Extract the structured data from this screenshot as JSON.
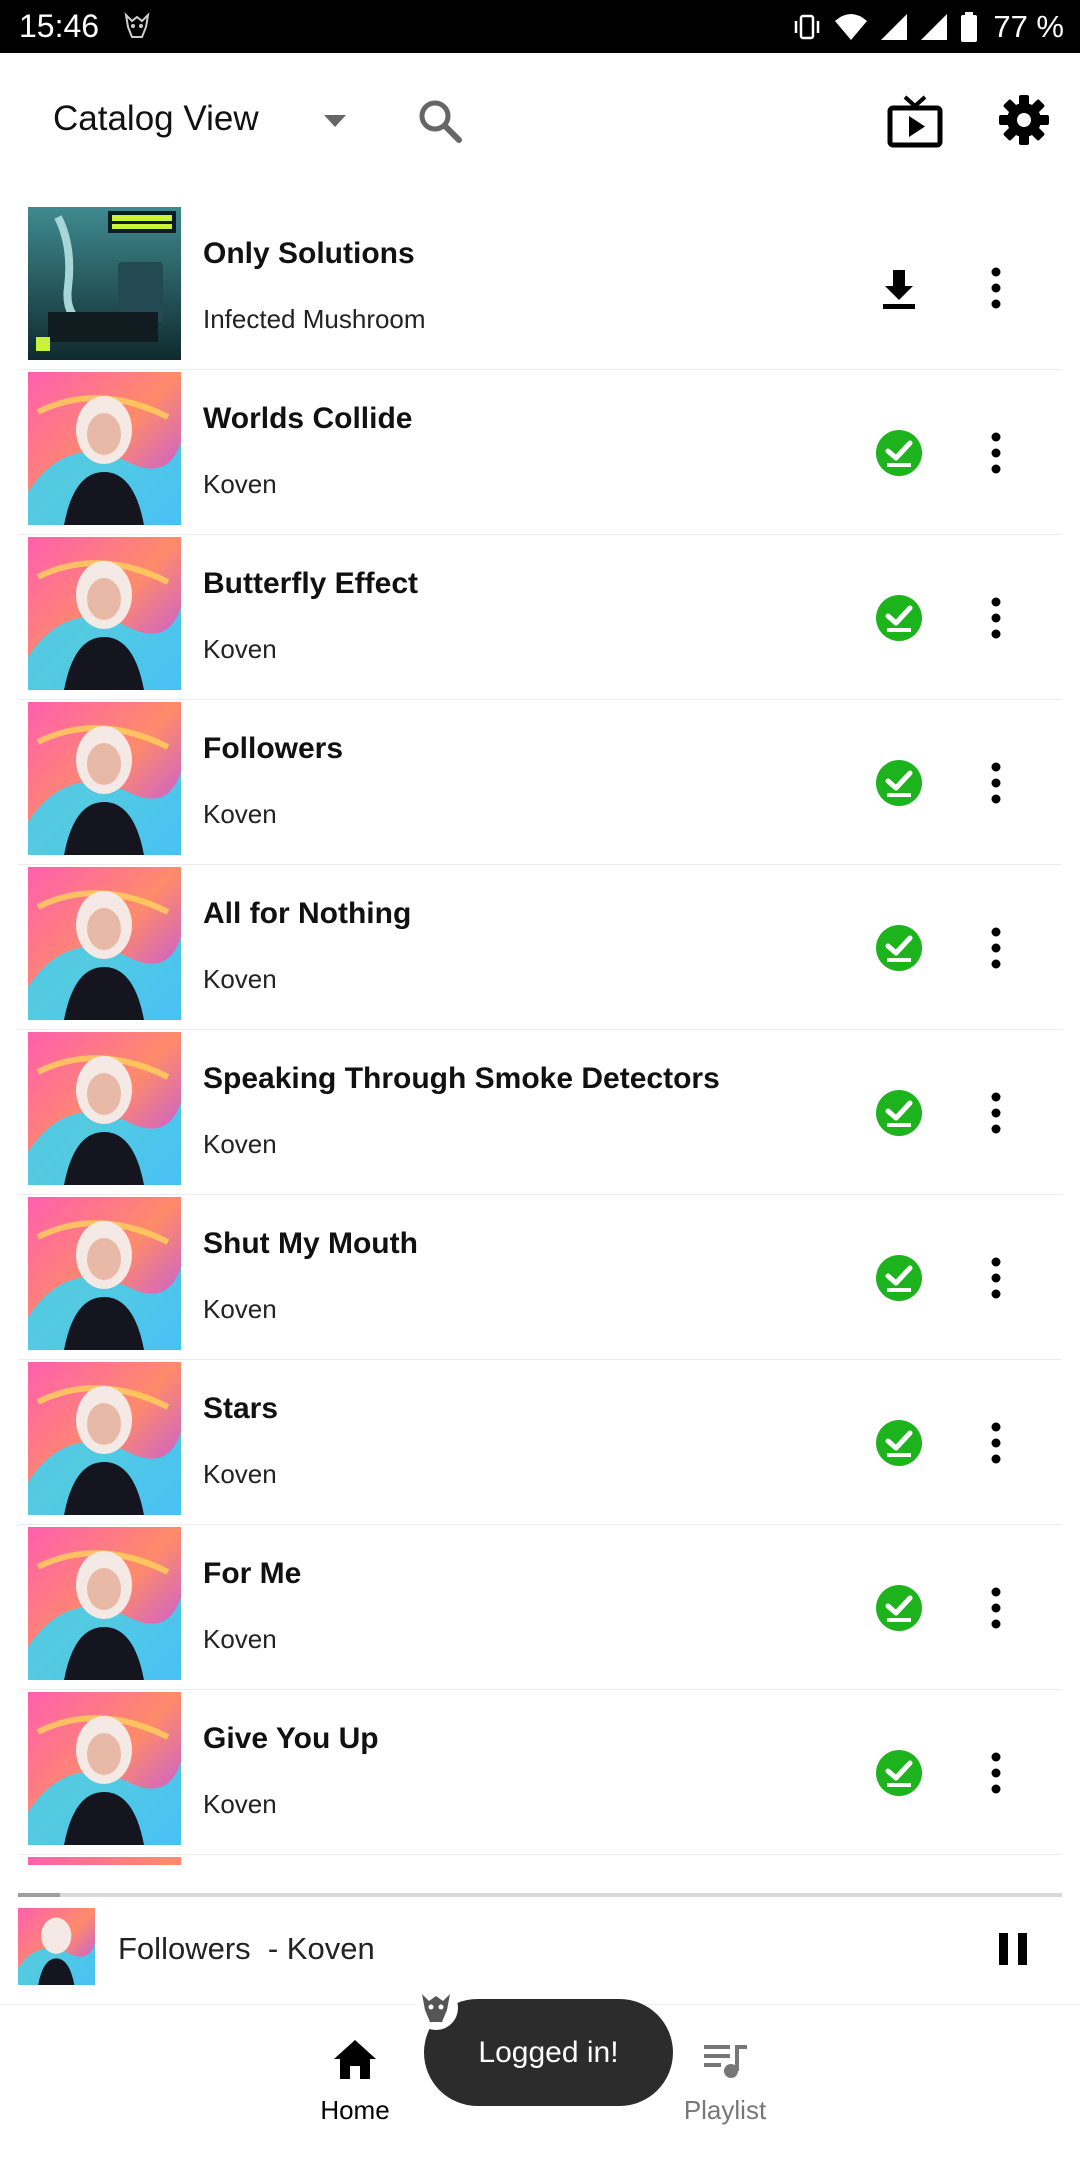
{
  "status_bar": {
    "time": "15:46",
    "battery": "77 %",
    "icons": [
      "app-notification-icon",
      "vibrate-icon",
      "wifi-icon",
      "signal-icon",
      "signal-icon-2",
      "battery-icon"
    ]
  },
  "header": {
    "title": "Catalog View",
    "icons": [
      "dropdown-arrow-icon",
      "search-icon",
      "cast-screen-icon",
      "settings-gear-icon"
    ]
  },
  "tracks": [
    {
      "title": "Only Solutions",
      "artist": "Infected Mushroom",
      "status": "download"
    },
    {
      "title": "Worlds Collide",
      "artist": "Koven",
      "status": "downloaded"
    },
    {
      "title": "Butterfly Effect",
      "artist": "Koven",
      "status": "downloaded"
    },
    {
      "title": "Followers",
      "artist": "Koven",
      "status": "downloaded"
    },
    {
      "title": "All for Nothing",
      "artist": "Koven",
      "status": "downloaded"
    },
    {
      "title": "Speaking Through Smoke Detectors",
      "artist": "Koven",
      "status": "downloaded"
    },
    {
      "title": "Shut My Mouth",
      "artist": "Koven",
      "status": "downloaded"
    },
    {
      "title": "Stars",
      "artist": "Koven",
      "status": "downloaded"
    },
    {
      "title": "For Me",
      "artist": "Koven",
      "status": "downloaded"
    },
    {
      "title": "Give You Up",
      "artist": "Koven",
      "status": "downloaded"
    }
  ],
  "now_playing": {
    "text": "Followers  - Koven",
    "progress_fraction": 0.04
  },
  "bottom_nav": {
    "home_label": "Home",
    "playlist_label": "Playlist"
  },
  "toast": {
    "message": "Logged in!"
  },
  "colors": {
    "downloaded_green": "#1db31d",
    "status_bar": "#000000",
    "toast_bg": "#2c2c2c"
  }
}
